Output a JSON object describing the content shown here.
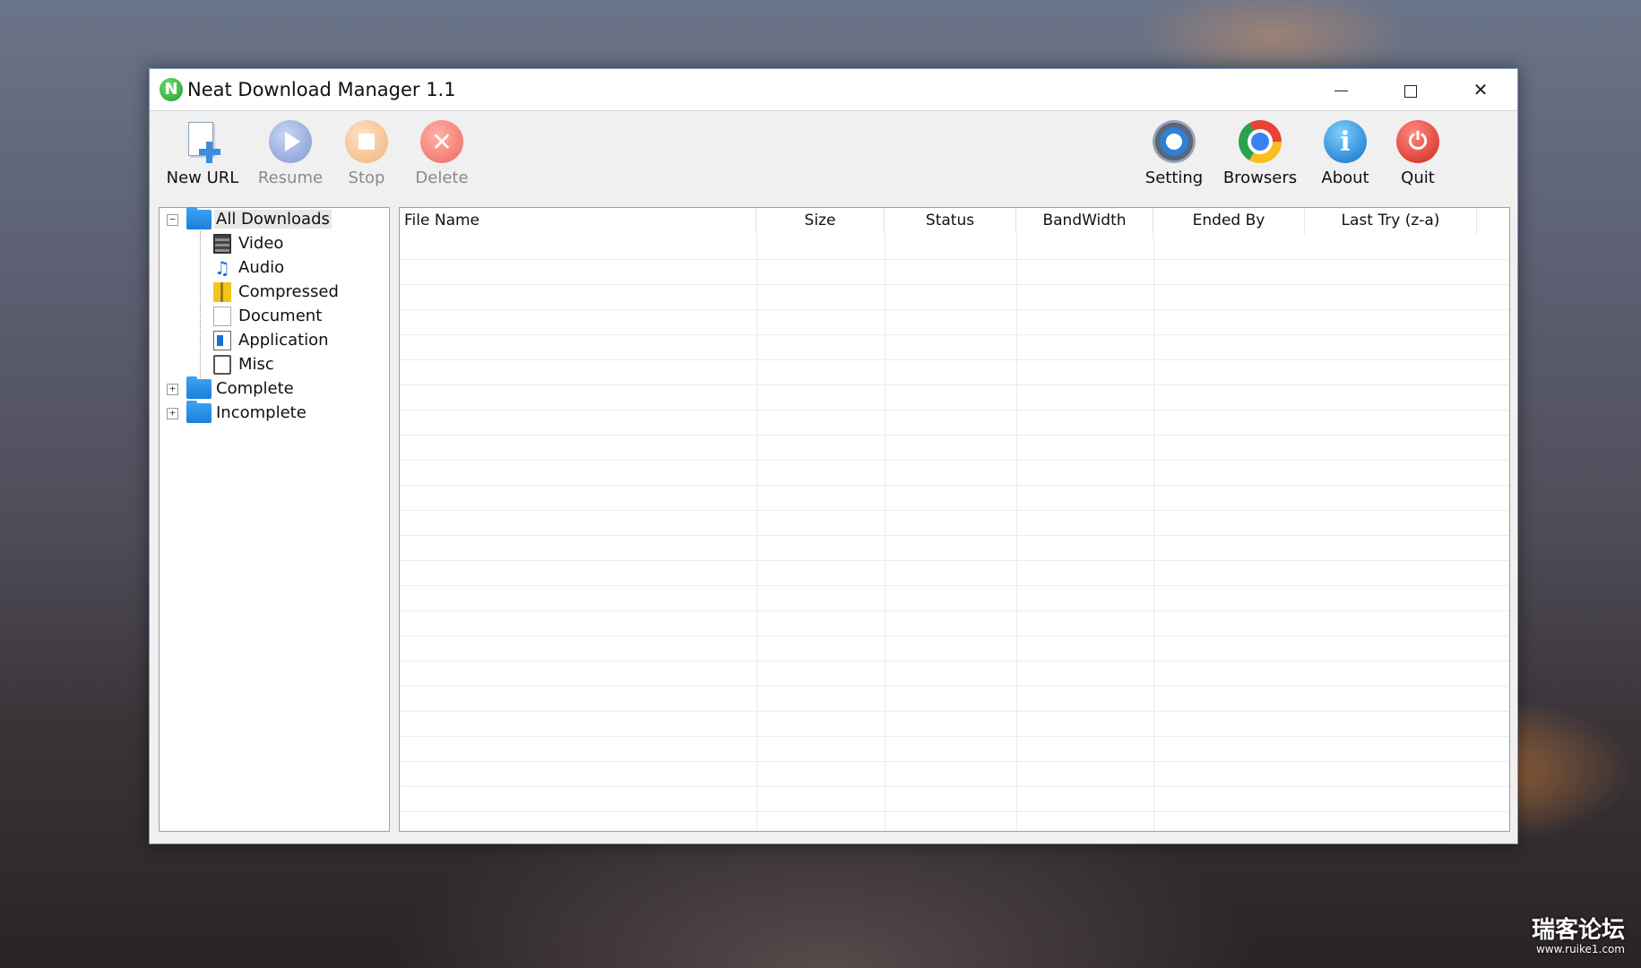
{
  "window": {
    "title": "Neat Download Manager 1.1",
    "logo_letter": "N",
    "controls": {
      "minimize": "minimize",
      "maximize": "maximize",
      "close": "✕"
    }
  },
  "toolbar": {
    "new_url": "New URL",
    "resume": "Resume",
    "stop": "Stop",
    "delete": "Delete",
    "setting": "Setting",
    "browsers": "Browsers",
    "about": "About",
    "quit": "Quit",
    "icons": {
      "delete": "✕",
      "about": "i",
      "quit": "⏻"
    }
  },
  "tree": {
    "all_downloads": "All Downloads",
    "video": "Video",
    "audio": "Audio",
    "compressed": "Compressed",
    "document": "Document",
    "application": "Application",
    "misc": "Misc",
    "complete": "Complete",
    "incomplete": "Incomplete",
    "expanded_symbol": "−",
    "collapsed_symbol": "+",
    "audio_glyph": "♫"
  },
  "list": {
    "columns": {
      "file_name": "File Name",
      "size": "Size",
      "status": "Status",
      "bandwidth": "BandWidth",
      "ended_by": "Ended By",
      "last_try": "Last Try (z-a)"
    },
    "rows": []
  },
  "watermark": {
    "main": "瑞客论坛",
    "sub": "www.ruike1.com"
  },
  "colors": {
    "window_border": "#7a9cc6",
    "folder_blue": "#1a7fd8",
    "logo_green": "#1e9a2c"
  }
}
